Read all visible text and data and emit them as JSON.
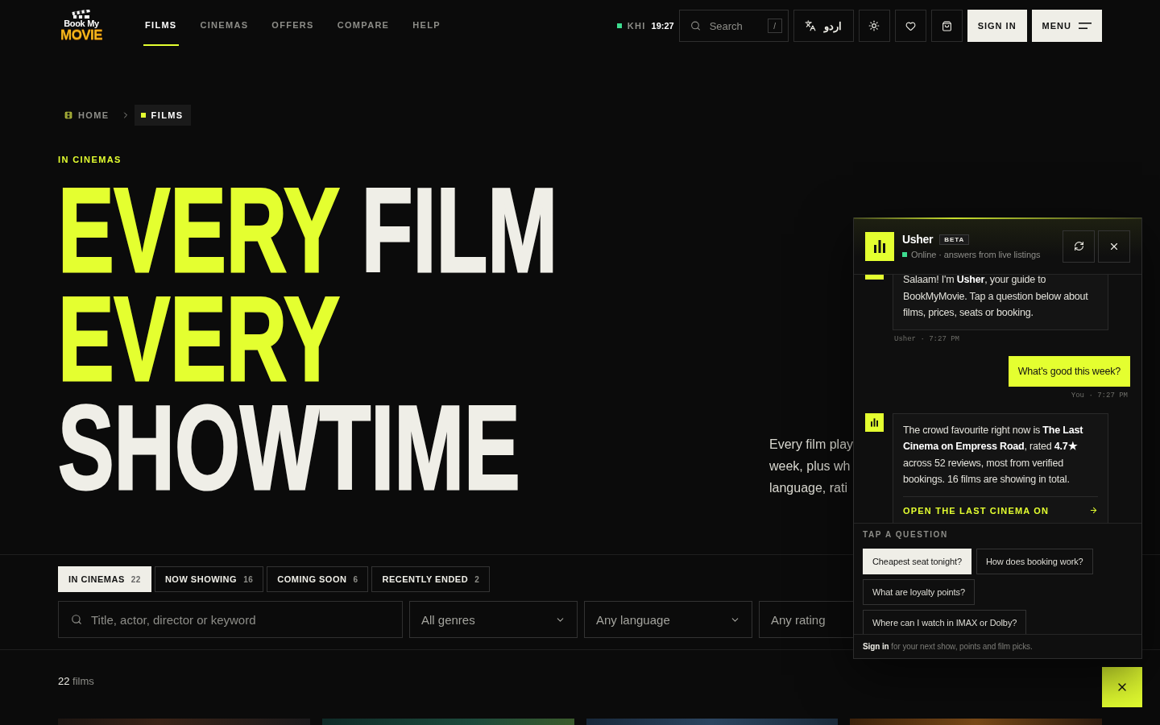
{
  "header": {
    "logo": {
      "line_1": "Book My",
      "line_2": "MOVIE"
    },
    "nav": [
      {
        "label": "FILMS",
        "selected": true
      },
      {
        "label": "CINEMAS",
        "selected": false
      },
      {
        "label": "OFFERS",
        "selected": false
      },
      {
        "label": "COMPARE",
        "selected": false
      },
      {
        "label": "HELP",
        "selected": false
      }
    ],
    "clock": {
      "city": "KHI",
      "time": "19:27"
    },
    "search": {
      "placeholder": "Search",
      "shortcut": "/"
    },
    "language_button": "اردو",
    "sign_in": "SIGN IN",
    "menu": "MENU"
  },
  "breadcrumb": [
    {
      "label": "HOME",
      "selected": false
    },
    {
      "label": "FILMS",
      "selected": true
    }
  ],
  "hero": {
    "eyebrow": "IN CINEMAS",
    "heading": [
      {
        "words": [
          {
            "text": "EVERY",
            "accent": true
          },
          {
            "text": "FILM",
            "accent": false
          }
        ]
      },
      {
        "words": [
          {
            "text": "EVERY",
            "accent": true
          }
        ]
      },
      {
        "words": [
          {
            "text": "SHOWTIME",
            "accent": false
          }
        ]
      }
    ],
    "intro_lines": [
      "Every film play",
      "week, plus wh",
      "language, rati"
    ]
  },
  "tabs": [
    {
      "label": "IN CINEMAS",
      "count": "22",
      "selected": true
    },
    {
      "label": "NOW SHOWING",
      "count": "16",
      "selected": false
    },
    {
      "label": "COMING SOON",
      "count": "6",
      "selected": false
    },
    {
      "label": "RECENTLY ENDED",
      "count": "2",
      "selected": false
    }
  ],
  "filters": {
    "search_placeholder": "Title, actor, director or keyword",
    "selects": [
      {
        "value": "All genres"
      },
      {
        "value": "Any language"
      },
      {
        "value": "Any rating"
      }
    ]
  },
  "results": {
    "count": "22",
    "label": "films"
  },
  "chat": {
    "name": "Usher",
    "badge": "BETA",
    "status": {
      "online": true,
      "text": "Online · answers from live listings"
    },
    "messages": [
      {
        "kind": "bot",
        "text": "Salaam! I'm **Usher**, your guide to BookMyMovie. Tap a question below about films, prices, seats or booking.",
        "meta": "Usher · 7:27 PM"
      },
      {
        "kind": "user",
        "text": "What's good this week?",
        "meta": "You · 7:27 PM"
      },
      {
        "kind": "bot",
        "text": "The crowd favourite right now is **The Last Cinema on Empress Road**, rated **4.7★** across 52 reviews, most from verified bookings. 16 films are showing in total.",
        "action": "OPEN THE LAST CINEMA ON"
      }
    ],
    "questions_label": "TAP A QUESTION",
    "questions": [
      {
        "label": "Cheapest seat tonight?",
        "selected": true
      },
      {
        "label": "How does booking work?",
        "selected": false
      },
      {
        "label": "What are loyalty points?",
        "selected": false
      },
      {
        "label": "Where can I watch in IMAX or Dolby?",
        "selected": false
      }
    ],
    "footer": {
      "link": "Sign in",
      "text": "for your next show, points and film picks."
    }
  }
}
